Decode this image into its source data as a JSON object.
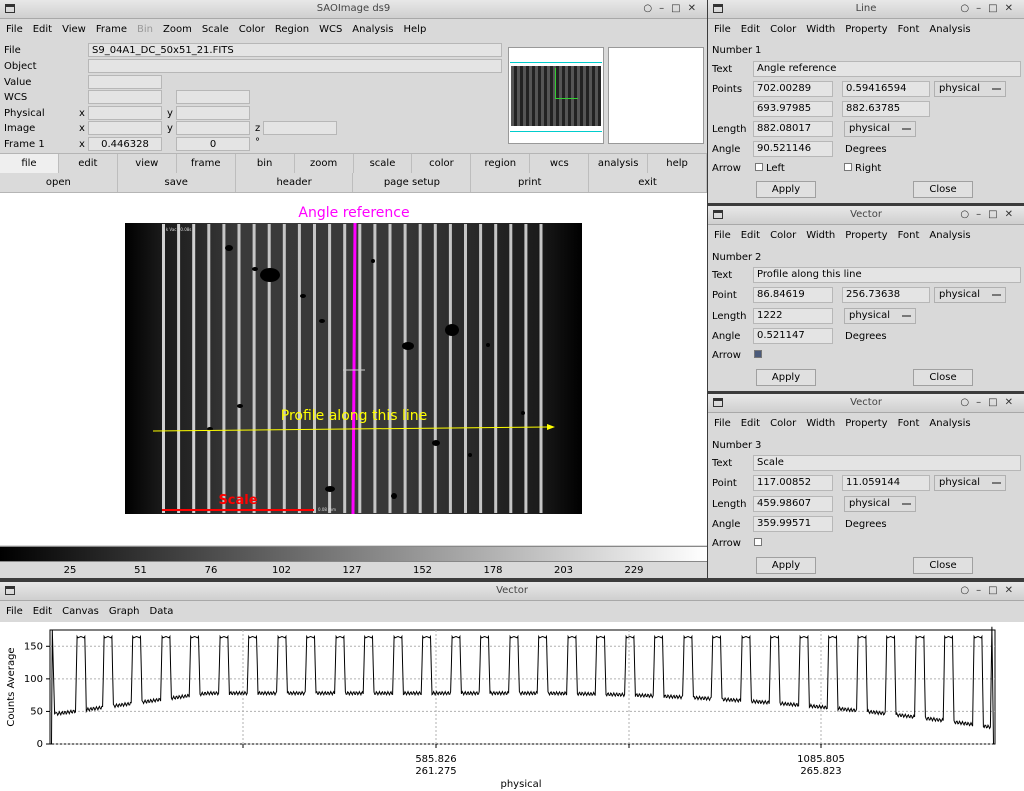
{
  "ds9": {
    "title": "SAOImage ds9",
    "menu": [
      "File",
      "Edit",
      "View",
      "Frame",
      "Bin",
      "Zoom",
      "Scale",
      "Color",
      "Region",
      "WCS",
      "Analysis",
      "Help"
    ],
    "disabled_menu": "Bin",
    "info": {
      "file_label": "File",
      "file_value": "S9_04A1_DC_50x51_21.FITS",
      "object_label": "Object",
      "value_label": "Value",
      "wcs_label": "WCS",
      "physical_label": "Physical",
      "image_label": "Image",
      "frame_label": "Frame 1",
      "x": "x",
      "y": "y",
      "z": "z",
      "zoom_value": "0.446328",
      "angle_value": "0",
      "deg": "°"
    },
    "buttons": [
      "file",
      "edit",
      "view",
      "frame",
      "bin",
      "zoom",
      "scale",
      "color",
      "region",
      "wcs",
      "analysis",
      "help"
    ],
    "subbuttons": [
      "open",
      "save",
      "header",
      "page setup",
      "print",
      "exit"
    ],
    "canvas": {
      "angle_label": "Angle reference",
      "profile_label": "Profile along this line",
      "scale_label": "Scale",
      "image_corner_text": "[ k Vac : 0.08s ]",
      "scale_tick_text": "0.08 mm"
    },
    "colorbar_ticks": [
      "25",
      "51",
      "76",
      "102",
      "127",
      "152",
      "178",
      "203",
      "229"
    ]
  },
  "line_dialog": {
    "title": "Line",
    "menu": [
      "File",
      "Edit",
      "Color",
      "Width",
      "Property",
      "Font",
      "Analysis"
    ],
    "number_label": "Number",
    "number": "1",
    "text_label": "Text",
    "text": "Angle reference",
    "points_label": "Points",
    "p1x": "702.00289",
    "p1y": "0.59416594",
    "p2x": "693.97985",
    "p2y": "882.63785",
    "coord": "physical",
    "length_label": "Length",
    "length": "882.08017",
    "length_coord": "physical",
    "angle_label": "Angle",
    "angle": "90.521146",
    "degrees": "Degrees",
    "arrow_label": "Arrow",
    "left": "Left",
    "right": "Right",
    "apply": "Apply",
    "close": "Close"
  },
  "vector1": {
    "title": "Vector",
    "menu": [
      "File",
      "Edit",
      "Color",
      "Width",
      "Property",
      "Font",
      "Analysis"
    ],
    "number_label": "Number",
    "number": "2",
    "text_label": "Text",
    "text": "Profile along this line",
    "point_label": "Point",
    "px": "86.84619",
    "py": "256.73638",
    "coord": "physical",
    "length_label": "Length",
    "length": "1222",
    "length_coord": "physical",
    "angle_label": "Angle",
    "angle": "0.521147",
    "degrees": "Degrees",
    "arrow_label": "Arrow",
    "apply": "Apply",
    "close": "Close"
  },
  "vector2": {
    "title": "Vector",
    "menu": [
      "File",
      "Edit",
      "Color",
      "Width",
      "Property",
      "Font",
      "Analysis"
    ],
    "number_label": "Number",
    "number": "3",
    "text_label": "Text",
    "text": "Scale",
    "point_label": "Point",
    "px": "117.00852",
    "py": "11.059144",
    "coord": "physical",
    "length_label": "Length",
    "length": "459.98607",
    "length_coord": "physical",
    "angle_label": "Angle",
    "angle": "359.99571",
    "degrees": "Degrees",
    "arrow_label": "Arrow",
    "apply": "Apply",
    "close": "Close"
  },
  "graph": {
    "title": "Vector",
    "menu": [
      "File",
      "Edit",
      "Canvas",
      "Graph",
      "Data"
    ],
    "ylabel": "Counts Average",
    "xlabel": "physical",
    "yticks": [
      "0",
      "50",
      "100",
      "150"
    ],
    "xtick1_a": "585.826",
    "xtick1_b": "261.275",
    "xtick2_a": "1085.805",
    "xtick2_b": "265.823"
  },
  "chart_data": {
    "type": "line",
    "title": "",
    "xlabel": "physical",
    "ylabel": "Counts Average",
    "ylim": [
      0,
      175
    ],
    "xlim": [
      0,
      1222
    ],
    "grid": true,
    "series": [
      {
        "peaks_x": [
          40,
          75,
          112,
          150,
          187,
          225,
          262,
          300,
          337,
          375,
          412,
          450,
          487,
          525,
          562,
          600,
          637,
          675,
          712,
          750,
          787,
          825,
          862,
          900,
          937,
          975,
          1012,
          1050,
          1087,
          1125,
          1162,
          1200
        ],
        "peak_value": 165,
        "baseline_start": 45,
        "baseline_mid": 78,
        "baseline_end": 25
      }
    ],
    "colors": {
      "line": "#000000",
      "grid": "#b0b0b0"
    }
  }
}
